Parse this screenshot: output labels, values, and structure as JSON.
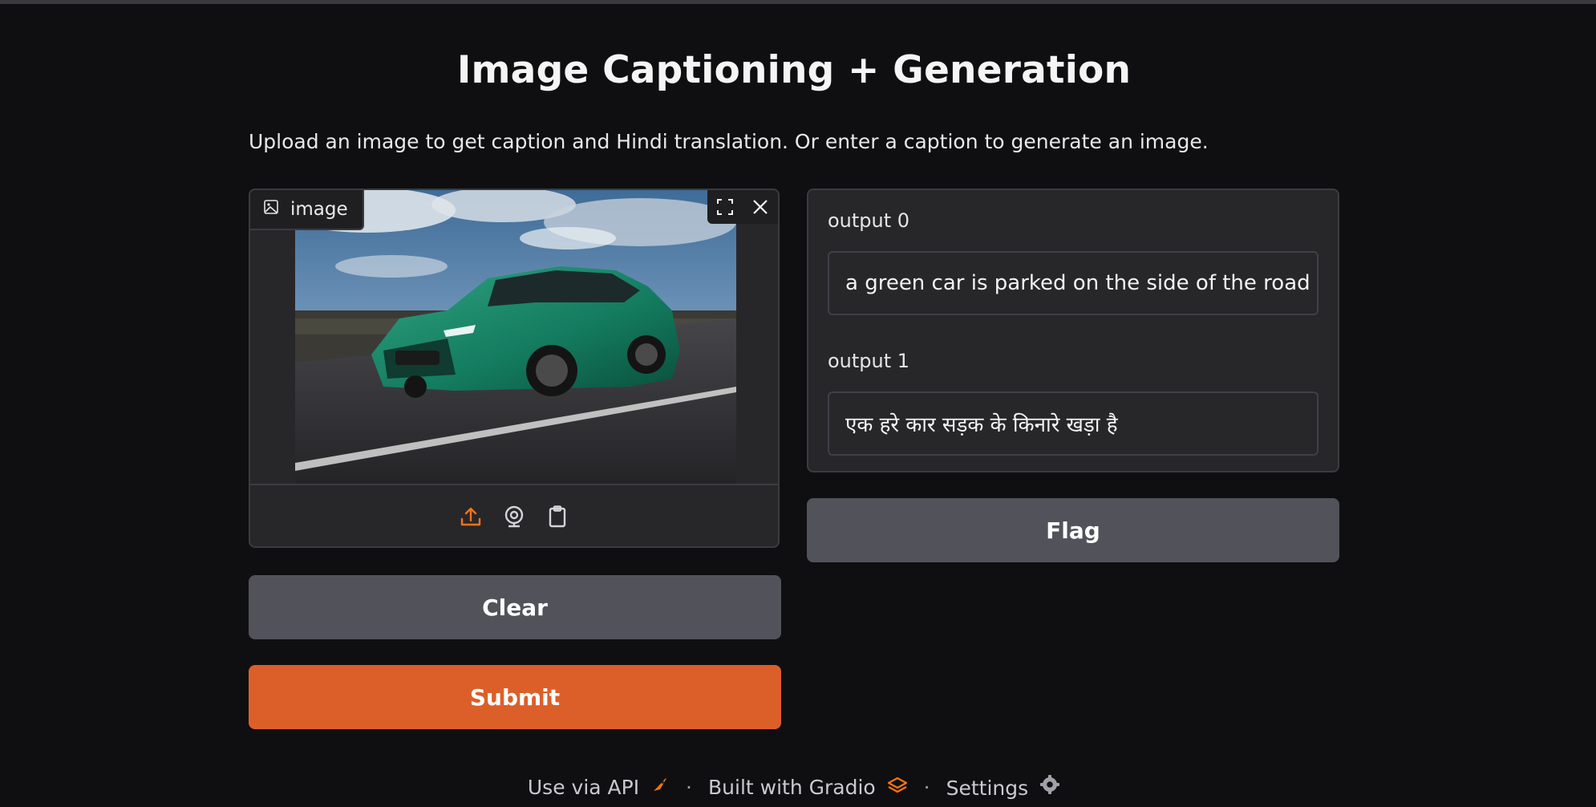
{
  "page": {
    "title": "Image Captioning + Generation",
    "description": "Upload an image to get caption and Hindi translation. Or enter a caption to generate an image."
  },
  "image_input": {
    "label": "image",
    "image_subject": "green car",
    "source_icons": [
      "upload-icon",
      "webcam-icon",
      "clipboard-icon"
    ],
    "tool_icons": [
      "fullscreen-icon",
      "close-icon"
    ]
  },
  "buttons": {
    "clear": "Clear",
    "submit": "Submit",
    "flag": "Flag"
  },
  "outputs": [
    {
      "label": "output 0",
      "value": "a green car is parked on the side of the road"
    },
    {
      "label": "output 1",
      "value": "एक हरे कार सड़क के किनारे खड़ा है"
    }
  ],
  "footer": {
    "api": "Use via API",
    "built": "Built with Gradio",
    "settings": "Settings",
    "separator": "·"
  },
  "colors": {
    "background": "#0f0f11",
    "panel": "#27272a",
    "secondary_button": "#52525b",
    "primary_button": "#dc5f2a",
    "accent_icon": "#f97316"
  }
}
